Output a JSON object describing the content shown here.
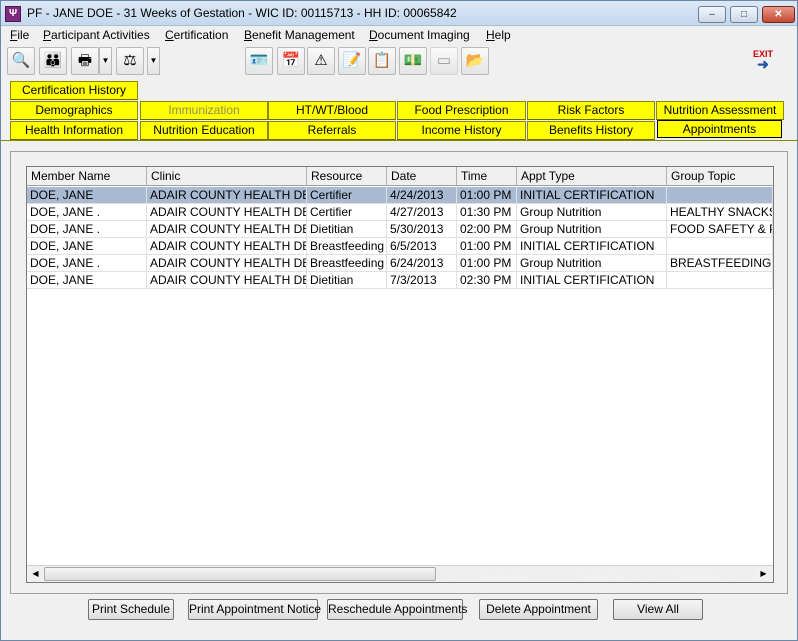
{
  "window": {
    "title": "PF - JANE DOE - 31 Weeks of Gestation - WIC ID: 00115713 - HH ID: 00065842",
    "app_icon": "wic-app-icon",
    "controls": {
      "minimize": "–",
      "maximize": "□",
      "close": "✕"
    }
  },
  "menu": [
    "File",
    "Participant Activities",
    "Certification",
    "Benefit Management",
    "Document Imaging",
    "Help"
  ],
  "toolbar": {
    "left_icons": [
      "magnifier-icon",
      "family-icon",
      "printer-icon",
      "scale-tools-icon"
    ],
    "center_icons": [
      "id-card-icon",
      "calendar-icon",
      "warning-icon",
      "settings-note-icon",
      "form-icon",
      "voucher-icon",
      "disabled-card-icon",
      "folder-arrow-icon"
    ],
    "exit_label": "EXIT"
  },
  "tabs": {
    "row1": [
      "Certification History"
    ],
    "row2": [
      "Demographics",
      "Immunization",
      "HT/WT/Blood",
      "Food Prescription",
      "Risk Factors",
      "Nutrition Assessment"
    ],
    "row3": [
      "Health Information",
      "Nutrition Education",
      "Referrals",
      "Income History",
      "Benefits History",
      "Appointments"
    ],
    "active": "Appointments",
    "disabled": "Immunization",
    "tab_color": "#ffff00"
  },
  "grid": {
    "columns": [
      "Member Name",
      "Clinic",
      "Resource",
      "Date",
      "Time",
      "Appt Type",
      "Group Topic"
    ],
    "rows": [
      [
        "DOE, JANE",
        "ADAIR COUNTY HEALTH DE",
        "Certifier",
        "4/24/2013",
        "01:00 PM",
        "INITIAL CERTIFICATION",
        ""
      ],
      [
        "DOE, JANE  .",
        "ADAIR COUNTY HEALTH DE",
        "Certifier",
        "4/27/2013",
        "01:30 PM",
        "Group Nutrition",
        "HEALTHY SNACKS"
      ],
      [
        "DOE, JANE  .",
        "ADAIR COUNTY HEALTH DE",
        "Dietitian",
        "5/30/2013",
        "02:00 PM",
        "Group Nutrition",
        "FOOD SAFETY & PR"
      ],
      [
        "DOE, JANE",
        "ADAIR COUNTY HEALTH DE",
        "Breastfeeding",
        "6/5/2013",
        "01:00 PM",
        "INITIAL CERTIFICATION",
        ""
      ],
      [
        "DOE, JANE  .",
        "ADAIR COUNTY HEALTH DE",
        "Breastfeeding",
        "6/24/2013",
        "01:00 PM",
        "Group Nutrition",
        "BREASTFEEDING C"
      ],
      [
        "DOE, JANE",
        "ADAIR COUNTY HEALTH DE",
        "Dietitian",
        "7/3/2013",
        "02:30 PM",
        "INITIAL CERTIFICATION",
        ""
      ]
    ],
    "selected_row": 0,
    "selected_color": "#a9bbd3"
  },
  "buttons": [
    "Print Schedule",
    "Print Appointment Notice",
    "Reschedule Appointments",
    "Delete Appointment",
    "View All"
  ]
}
